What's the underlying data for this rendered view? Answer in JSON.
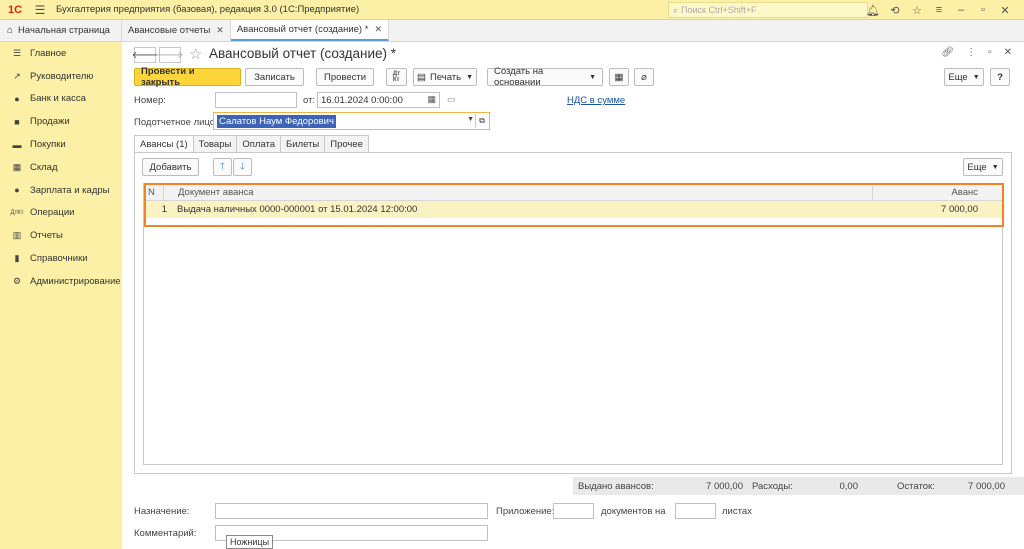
{
  "topbar": {
    "logo": "1С",
    "app_title": "Бухгалтерия предприятия (базовая), редакция 3.0  (1С:Предприятие)",
    "search_placeholder": "Поиск Ctrl+Shift+F"
  },
  "tabs": {
    "home": "Начальная страница",
    "items": [
      {
        "label": "Авансовые отчеты"
      },
      {
        "label": "Авансовый отчет (создание) *"
      }
    ]
  },
  "sidebar": {
    "items": [
      {
        "label": "Главное",
        "icon": "menu-icon"
      },
      {
        "label": "Руководителю",
        "icon": "trend-icon"
      },
      {
        "label": "Банк и касса",
        "icon": "bank-icon"
      },
      {
        "label": "Продажи",
        "icon": "bag-icon"
      },
      {
        "label": "Покупки",
        "icon": "cart-icon"
      },
      {
        "label": "Склад",
        "icon": "warehouse-icon"
      },
      {
        "label": "Зарплата и кадры",
        "icon": "person-icon"
      },
      {
        "label": "Операции",
        "icon": "dt-kt-icon"
      },
      {
        "label": "Отчеты",
        "icon": "chart-icon"
      },
      {
        "label": "Справочники",
        "icon": "book-icon"
      },
      {
        "label": "Администрирование",
        "icon": "gear-icon"
      }
    ]
  },
  "form": {
    "title": "Авансовый отчет (создание) *",
    "toolbar": {
      "post_close": "Провести и закрыть",
      "save": "Записать",
      "post": "Провести",
      "print": "Печать",
      "create_based": "Создать на основании",
      "more": "Еще",
      "help": "?"
    },
    "number_label": "Номер:",
    "number_value": "",
    "date_label": "от:",
    "date_value": "16.01.2024  0:00:00",
    "vat_link": "НДС в сумме",
    "subject_label": "Подотчетное лицо:",
    "subject_value": "Салатов Наум Федорович",
    "tabs": [
      "Авансы (1)",
      "Товары",
      "Оплата",
      "Билеты",
      "Прочее"
    ],
    "add_button": "Добавить",
    "table_more": "Еще",
    "table": {
      "headers": {
        "n": "N",
        "doc": "Документ аванса",
        "sum": "Аванс"
      },
      "rows": [
        {
          "n": "1",
          "doc": "Выдача наличных 0000-000001 от 15.01.2024 12:00:00",
          "sum": "7 000,00"
        }
      ]
    },
    "totals": {
      "issued_label": "Выдано авансов:",
      "issued_value": "7 000,00",
      "expenses_label": "Расходы:",
      "expenses_value": "0,00",
      "balance_label": "Остаток:",
      "balance_value": "7 000,00"
    },
    "purpose_label": "Назначение:",
    "attachment_label": "Приложение:",
    "docs_on_label": "документов на",
    "sheets_label": "листах",
    "comment_label": "Комментарий:",
    "tooltip": "Ножницы"
  },
  "colors": {
    "sidebar_bg": "#fbf0a6",
    "primary_button": "#fbd53a",
    "highlight_border": "#ef8428",
    "selected_row": "#fbf2c4",
    "link": "#1a54a8"
  }
}
